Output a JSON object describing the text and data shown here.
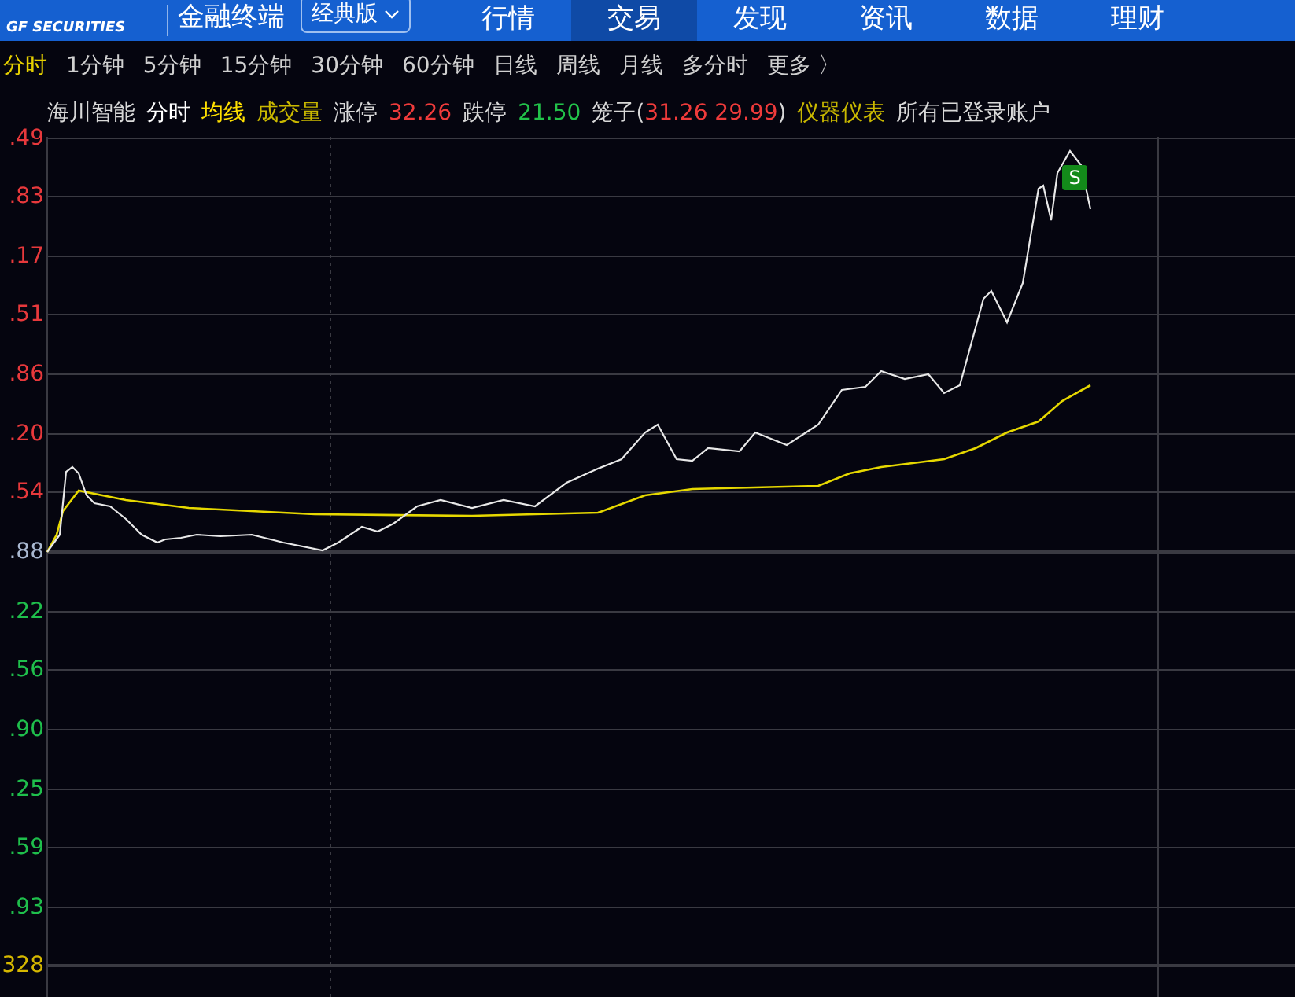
{
  "header": {
    "logo_subtext": "GF SECURITIES",
    "product": "金融终端",
    "edition": "经典版",
    "nav": [
      {
        "label": "行情",
        "selected": false
      },
      {
        "label": "交易",
        "selected": true
      },
      {
        "label": "发现",
        "selected": false
      },
      {
        "label": "资讯",
        "selected": false
      },
      {
        "label": "数据",
        "selected": false
      },
      {
        "label": "理财",
        "selected": false
      }
    ]
  },
  "periods": [
    {
      "label": "分时",
      "selected": true
    },
    {
      "label": "1分钟",
      "selected": false
    },
    {
      "label": "5分钟",
      "selected": false
    },
    {
      "label": "15分钟",
      "selected": false
    },
    {
      "label": "30分钟",
      "selected": false
    },
    {
      "label": "60分钟",
      "selected": false
    },
    {
      "label": "日线",
      "selected": false
    },
    {
      "label": "周线",
      "selected": false
    },
    {
      "label": "月线",
      "selected": false
    },
    {
      "label": "多分时",
      "selected": false
    },
    {
      "label": "更多 〉",
      "selected": false
    }
  ],
  "info": [
    {
      "text": "海川智能",
      "kind": "plain"
    },
    {
      "text": "分时",
      "kind": "white"
    },
    {
      "text": "均线",
      "kind": "yellow"
    },
    {
      "text": "成交量",
      "kind": "olive"
    },
    {
      "text": "涨停",
      "kind": "plain"
    },
    {
      "text": "32.26",
      "kind": "red"
    },
    {
      "text": "跌停",
      "kind": "plain"
    },
    {
      "text": "21.50",
      "kind": "green"
    },
    {
      "text": "笼子(",
      "kind": "plain",
      "tight": true
    },
    {
      "text": "31.26 29.99",
      "kind": "red",
      "tight": true
    },
    {
      "text": ")",
      "kind": "plain"
    },
    {
      "text": "仪器仪表",
      "kind": "olive"
    },
    {
      "text": "所有已登录账户",
      "kind": "plain"
    }
  ],
  "y_labels": [
    {
      "text": ".49",
      "kind": "up"
    },
    {
      "text": ".83",
      "kind": "up"
    },
    {
      "text": ".17",
      "kind": "up"
    },
    {
      "text": ".51",
      "kind": "up"
    },
    {
      "text": ".86",
      "kind": "up"
    },
    {
      "text": ".20",
      "kind": "up"
    },
    {
      "text": ".54",
      "kind": "up"
    },
    {
      "text": ".88",
      "kind": "flat"
    },
    {
      "text": ".22",
      "kind": "down"
    },
    {
      "text": ".56",
      "kind": "down"
    },
    {
      "text": ".90",
      "kind": "down"
    },
    {
      "text": ".25",
      "kind": "down"
    },
    {
      "text": ".59",
      "kind": "down"
    },
    {
      "text": ".93",
      "kind": "down"
    },
    {
      "text": "328",
      "kind": "volume"
    }
  ],
  "signal_badge": "S"
}
